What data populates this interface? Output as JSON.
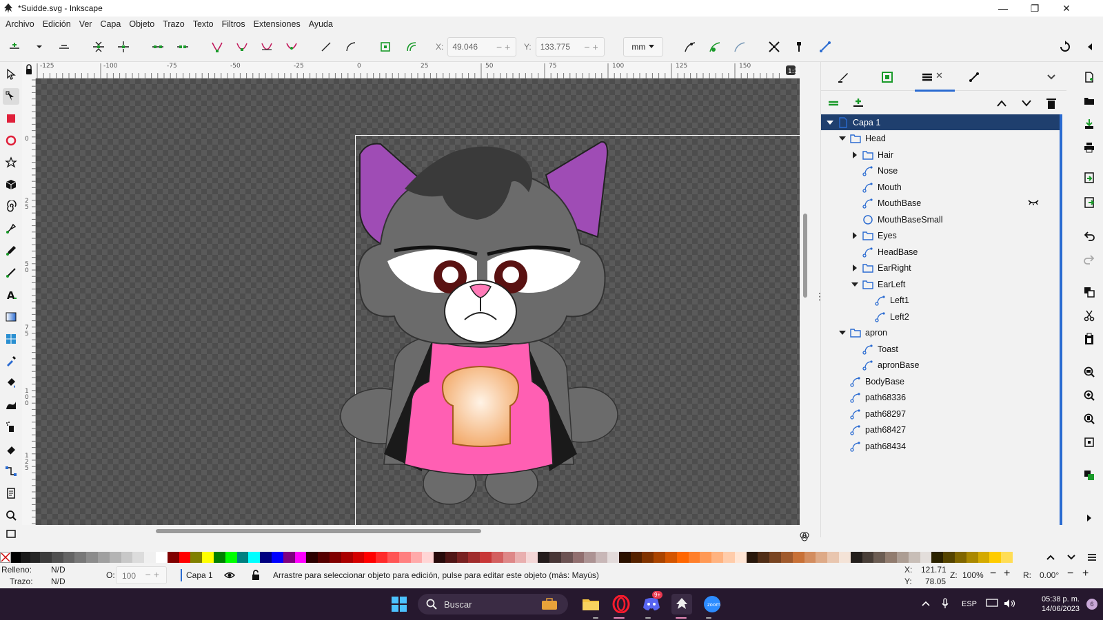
{
  "window": {
    "title": "*Suidde.svg - Inkscape",
    "controls": [
      "—",
      "❐",
      "✕"
    ]
  },
  "menu": [
    "Archivo",
    "Edición",
    "Ver",
    "Capa",
    "Objeto",
    "Trazo",
    "Texto",
    "Filtros",
    "Extensiones",
    "Ayuda"
  ],
  "toolbar": {
    "x_label": "X:",
    "x_value": "49.046",
    "y_label": "Y:",
    "y_value": "133.775",
    "unit": "mm"
  },
  "ruler": {
    "top_ticks": [
      "-125",
      "-100",
      "-75",
      "-50",
      "-25",
      "0",
      "25",
      "50",
      "75",
      "100",
      "125",
      "150"
    ],
    "left_ticks": [
      "0",
      "2 5",
      "5 0",
      "7 5",
      "1 0 0",
      "1 2 5"
    ]
  },
  "layers": [
    {
      "label": "Capa 1",
      "indent": 0,
      "icon": "layer-icon",
      "toggle": "open",
      "selected": true
    },
    {
      "label": "Head",
      "indent": 1,
      "icon": "folder-icon",
      "toggle": "open"
    },
    {
      "label": "Hair",
      "indent": 2,
      "icon": "folder-icon",
      "toggle": "closed"
    },
    {
      "label": "Nose",
      "indent": 2,
      "icon": "path-icon",
      "toggle": "none"
    },
    {
      "label": "Mouth",
      "indent": 2,
      "icon": "path-icon",
      "toggle": "none"
    },
    {
      "label": "MouthBase",
      "indent": 2,
      "icon": "path-icon",
      "toggle": "none",
      "hidden": true
    },
    {
      "label": "MouthBaseSmall",
      "indent": 2,
      "icon": "circle-icon",
      "toggle": "none"
    },
    {
      "label": "Eyes",
      "indent": 2,
      "icon": "folder-icon",
      "toggle": "closed"
    },
    {
      "label": "HeadBase",
      "indent": 2,
      "icon": "path-icon",
      "toggle": "none"
    },
    {
      "label": "EarRight",
      "indent": 2,
      "icon": "folder-icon",
      "toggle": "closed"
    },
    {
      "label": "EarLeft",
      "indent": 2,
      "icon": "folder-icon",
      "toggle": "open"
    },
    {
      "label": "Left1",
      "indent": 3,
      "icon": "path-icon",
      "toggle": "none"
    },
    {
      "label": "Left2",
      "indent": 3,
      "icon": "path-icon",
      "toggle": "none"
    },
    {
      "label": "apron",
      "indent": 1,
      "icon": "folder-icon",
      "toggle": "open"
    },
    {
      "label": "Toast",
      "indent": 2,
      "icon": "path-icon",
      "toggle": "none"
    },
    {
      "label": "apronBase",
      "indent": 2,
      "icon": "path-icon",
      "toggle": "none"
    },
    {
      "label": "BodyBase",
      "indent": 1,
      "icon": "path-icon",
      "toggle": "none"
    },
    {
      "label": "path68336",
      "indent": 1,
      "icon": "path-icon",
      "toggle": "none"
    },
    {
      "label": "path68297",
      "indent": 1,
      "icon": "path-icon",
      "toggle": "none"
    },
    {
      "label": "path68427",
      "indent": 1,
      "icon": "path-icon",
      "toggle": "none"
    },
    {
      "label": "path68434",
      "indent": 1,
      "icon": "path-icon",
      "toggle": "none"
    }
  ],
  "palette": [
    "#3c3c3c",
    "#505050",
    "#646464",
    "#787878",
    "#8c8c8c",
    "#a0a0a0",
    "#b4b4b4",
    "#c8c8c8",
    "#dcdcdc",
    "#f0f0f0",
    "#ffffff",
    "#800000",
    "#ff0000",
    "#808000",
    "#ffff00",
    "#008000",
    "#00ff00",
    "#008080",
    "#00ffff",
    "#000080",
    "#0000ff",
    "#800080",
    "#ff00ff",
    "#2b0000",
    "#550000",
    "#800000",
    "#aa0000",
    "#d40000",
    "#ff0000",
    "#ff2a2a",
    "#ff5555",
    "#ff8080",
    "#ffaaaa",
    "#ffd5d5",
    "#280b0b",
    "#501616",
    "#782121",
    "#a02c2c",
    "#c83737",
    "#d35f5f",
    "#de8787",
    "#e9afaf",
    "#f4d7d7",
    "#241c1c",
    "#483737",
    "#6c5353",
    "#916f6f",
    "#ac9393",
    "#c8b7b7",
    "#e3dbdb",
    "#2b1100",
    "#552200",
    "#803300",
    "#aa4400",
    "#d45500",
    "#ff6600",
    "#ff7f2a",
    "#ff9955",
    "#ffb380",
    "#ffccaa",
    "#ffe6d5",
    "#28170b",
    "#502d16",
    "#784421",
    "#a05a2c",
    "#c87137",
    "#d38d5f",
    "#deaa87",
    "#e9c6af",
    "#f4e3d7",
    "#241f1c",
    "#483e37",
    "#6c5d53",
    "#917c6f",
    "#ac9d93",
    "#c8beb7",
    "#e3dedb",
    "#2b2200",
    "#554400",
    "#806600",
    "#aa8800",
    "#d4aa00",
    "#ffcc00",
    "#ffdd55"
  ],
  "status": {
    "fill_label": "Relleno:",
    "fill_value": "N/D",
    "stroke_label": "Trazo:",
    "stroke_value": "N/D",
    "opacity_label": "O:",
    "opacity_value": "100",
    "layer": "Capa 1",
    "message": "Arrastre para seleccionar objeto para edición, pulse para editar este objeto (más: Mayús)",
    "x_label": "X:",
    "x_value": "121.71",
    "y_label": "Y:",
    "y_value": "78.05",
    "zoom_label": "Z:",
    "zoom_value": "100%",
    "rotation_label": "R:",
    "rotation_value": "0.00°"
  },
  "taskbar": {
    "search_placeholder": "Buscar",
    "language": "ESP",
    "time": "05:38 p. m.",
    "date": "14/06/2023",
    "discord_badge": "9+",
    "notification_count": "6"
  }
}
